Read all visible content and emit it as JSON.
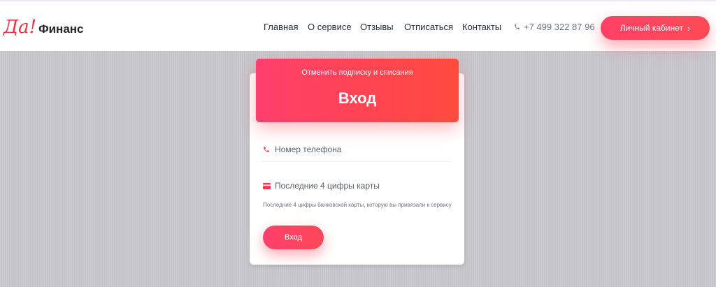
{
  "header": {
    "logo": {
      "part1": "Да!",
      "part2": "Финанс"
    },
    "nav": [
      {
        "label": "Главная"
      },
      {
        "label": "О сервисе"
      },
      {
        "label": "Отзывы"
      },
      {
        "label": "Отписаться"
      },
      {
        "label": "Контакты"
      }
    ],
    "phone": "+7 499 322 87 96",
    "cabinet_button": "Личный кабинет"
  },
  "form": {
    "subtitle": "Отменить подписку и списания",
    "title": "Вход",
    "phone_placeholder": "Номер телефона",
    "card_placeholder": "Последние 4 цифры карты",
    "hint": "Последние 4 цифры банковской карты, которую вы привязали к сервису",
    "submit_label": "Вход"
  },
  "colors": {
    "accent": "#ff4167",
    "logo_red": "#e8323f",
    "header_bg": "#ffffff",
    "page_bg": "#c9c9cd"
  },
  "icons": [
    "phone-icon",
    "chevron-right-icon",
    "card-icon"
  ]
}
